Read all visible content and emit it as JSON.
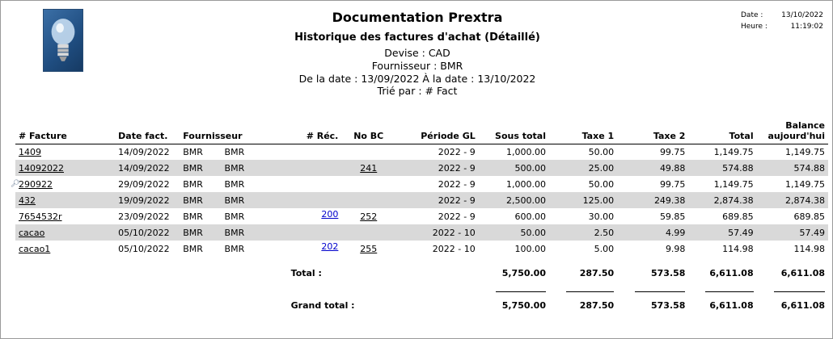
{
  "header": {
    "title": "Documentation Prextra",
    "subtitle": "Historique des factures d'achat (Détaillé)",
    "lines": [
      "Devise : CAD",
      "Fournisseur : BMR",
      "De la date : 13/09/2022  À la date : 13/10/2022",
      "Trié par : # Fact"
    ],
    "date_label": "Date :",
    "date_value": "13/10/2022",
    "time_label": "Heure :",
    "time_value": "11:19:02"
  },
  "columns": {
    "facture": "# Facture",
    "date": "Date fact.",
    "fournisseur": "Fournisseur",
    "rec": "# Réc.",
    "bc": "No BC",
    "periode": "Période GL",
    "sous_total": "Sous total",
    "taxe1": "Taxe 1",
    "taxe2": "Taxe 2",
    "total": "Total",
    "balance_1": "Balance",
    "balance_2": "aujourd'hui"
  },
  "rows": [
    {
      "facture": "1409",
      "date": "14/09/2022",
      "f1": "BMR",
      "f2": "BMR",
      "rec": "",
      "bc": "",
      "periode": "2022 - 9",
      "sous_total": "1,000.00",
      "taxe1": "50.00",
      "taxe2": "99.75",
      "total": "1,149.75",
      "balance": "1,149.75"
    },
    {
      "facture": "14092022",
      "date": "14/09/2022",
      "f1": "BMR",
      "f2": "BMR",
      "rec": "",
      "bc": "241",
      "periode": "2022 - 9",
      "sous_total": "500.00",
      "taxe1": "25.00",
      "taxe2": "49.88",
      "total": "574.88",
      "balance": "574.88"
    },
    {
      "facture": "290922",
      "date": "29/09/2022",
      "f1": "BMR",
      "f2": "BMR",
      "rec": "",
      "bc": "",
      "periode": "2022 - 9",
      "sous_total": "1,000.00",
      "taxe1": "50.00",
      "taxe2": "99.75",
      "total": "1,149.75",
      "balance": "1,149.75"
    },
    {
      "facture": "432",
      "date": "19/09/2022",
      "f1": "BMR",
      "f2": "BMR",
      "rec": "",
      "bc": "",
      "periode": "2022 - 9",
      "sous_total": "2,500.00",
      "taxe1": "125.00",
      "taxe2": "249.38",
      "total": "2,874.38",
      "balance": "2,874.38"
    },
    {
      "facture": "7654532r",
      "date": "23/09/2022",
      "f1": "BMR",
      "f2": "BMR",
      "rec": "200",
      "bc": "252",
      "periode": "2022 - 9",
      "sous_total": "600.00",
      "taxe1": "30.00",
      "taxe2": "59.85",
      "total": "689.85",
      "balance": "689.85"
    },
    {
      "facture": "cacao",
      "date": "05/10/2022",
      "f1": "BMR",
      "f2": "BMR",
      "rec": "",
      "bc": "",
      "periode": "2022 - 10",
      "sous_total": "50.00",
      "taxe1": "2.50",
      "taxe2": "4.99",
      "total": "57.49",
      "balance": "57.49"
    },
    {
      "facture": "cacao1",
      "date": "05/10/2022",
      "f1": "BMR",
      "f2": "BMR",
      "rec": "202",
      "bc": "255",
      "periode": "2022 - 10",
      "sous_total": "100.00",
      "taxe1": "5.00",
      "taxe2": "9.98",
      "total": "114.98",
      "balance": "114.98"
    }
  ],
  "totals": {
    "label": "Total :",
    "sous_total": "5,750.00",
    "taxe1": "287.50",
    "taxe2": "573.58",
    "total": "6,611.08",
    "balance": "6,611.08"
  },
  "grand_total": {
    "label": "Grand total :",
    "sous_total": "5,750.00",
    "taxe1": "287.50",
    "taxe2": "573.58",
    "total": "6,611.08",
    "balance": "6,611.08"
  },
  "icons": {
    "logo": "lightbulb-icon",
    "row_tip": "magnifier-icon"
  }
}
